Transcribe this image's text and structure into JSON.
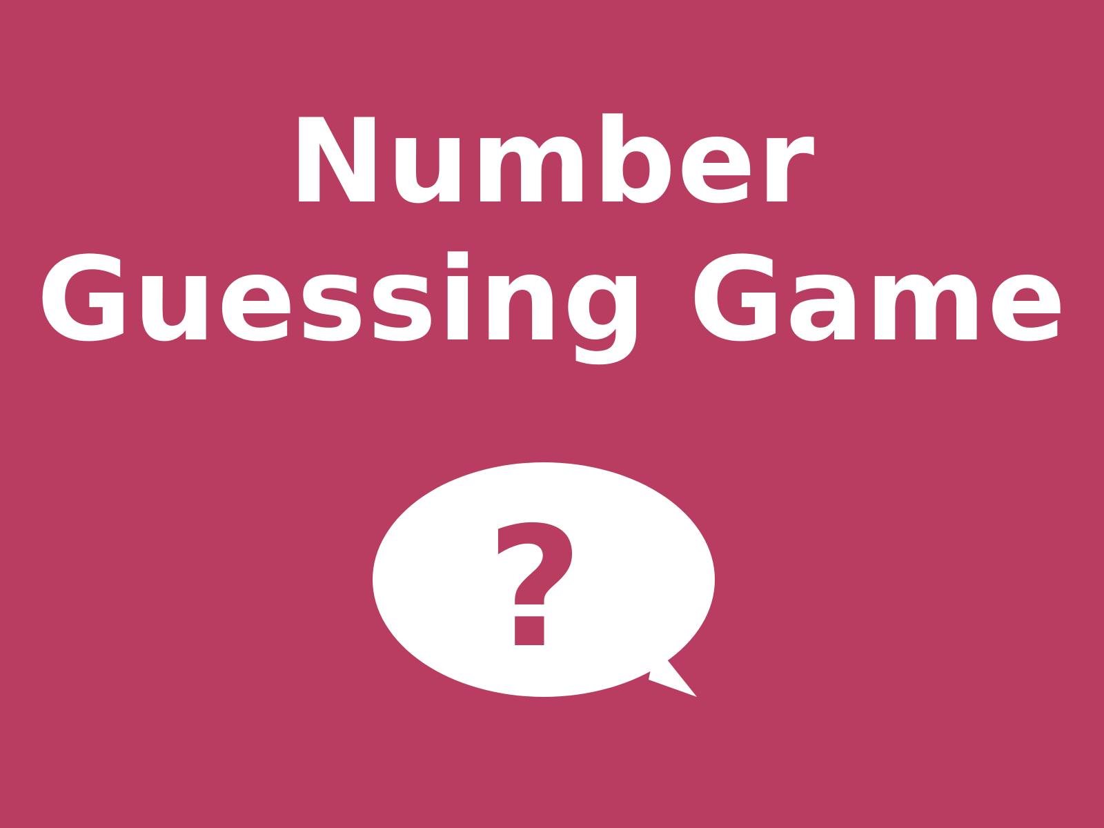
{
  "title": {
    "line1": "Number",
    "line2": "Guessing Game"
  },
  "bubble": {
    "icon": "question-speech-bubble-icon",
    "glyph": "?"
  },
  "colors": {
    "background": "#b83d61",
    "foreground": "#ffffff",
    "accent": "#b83d61"
  }
}
